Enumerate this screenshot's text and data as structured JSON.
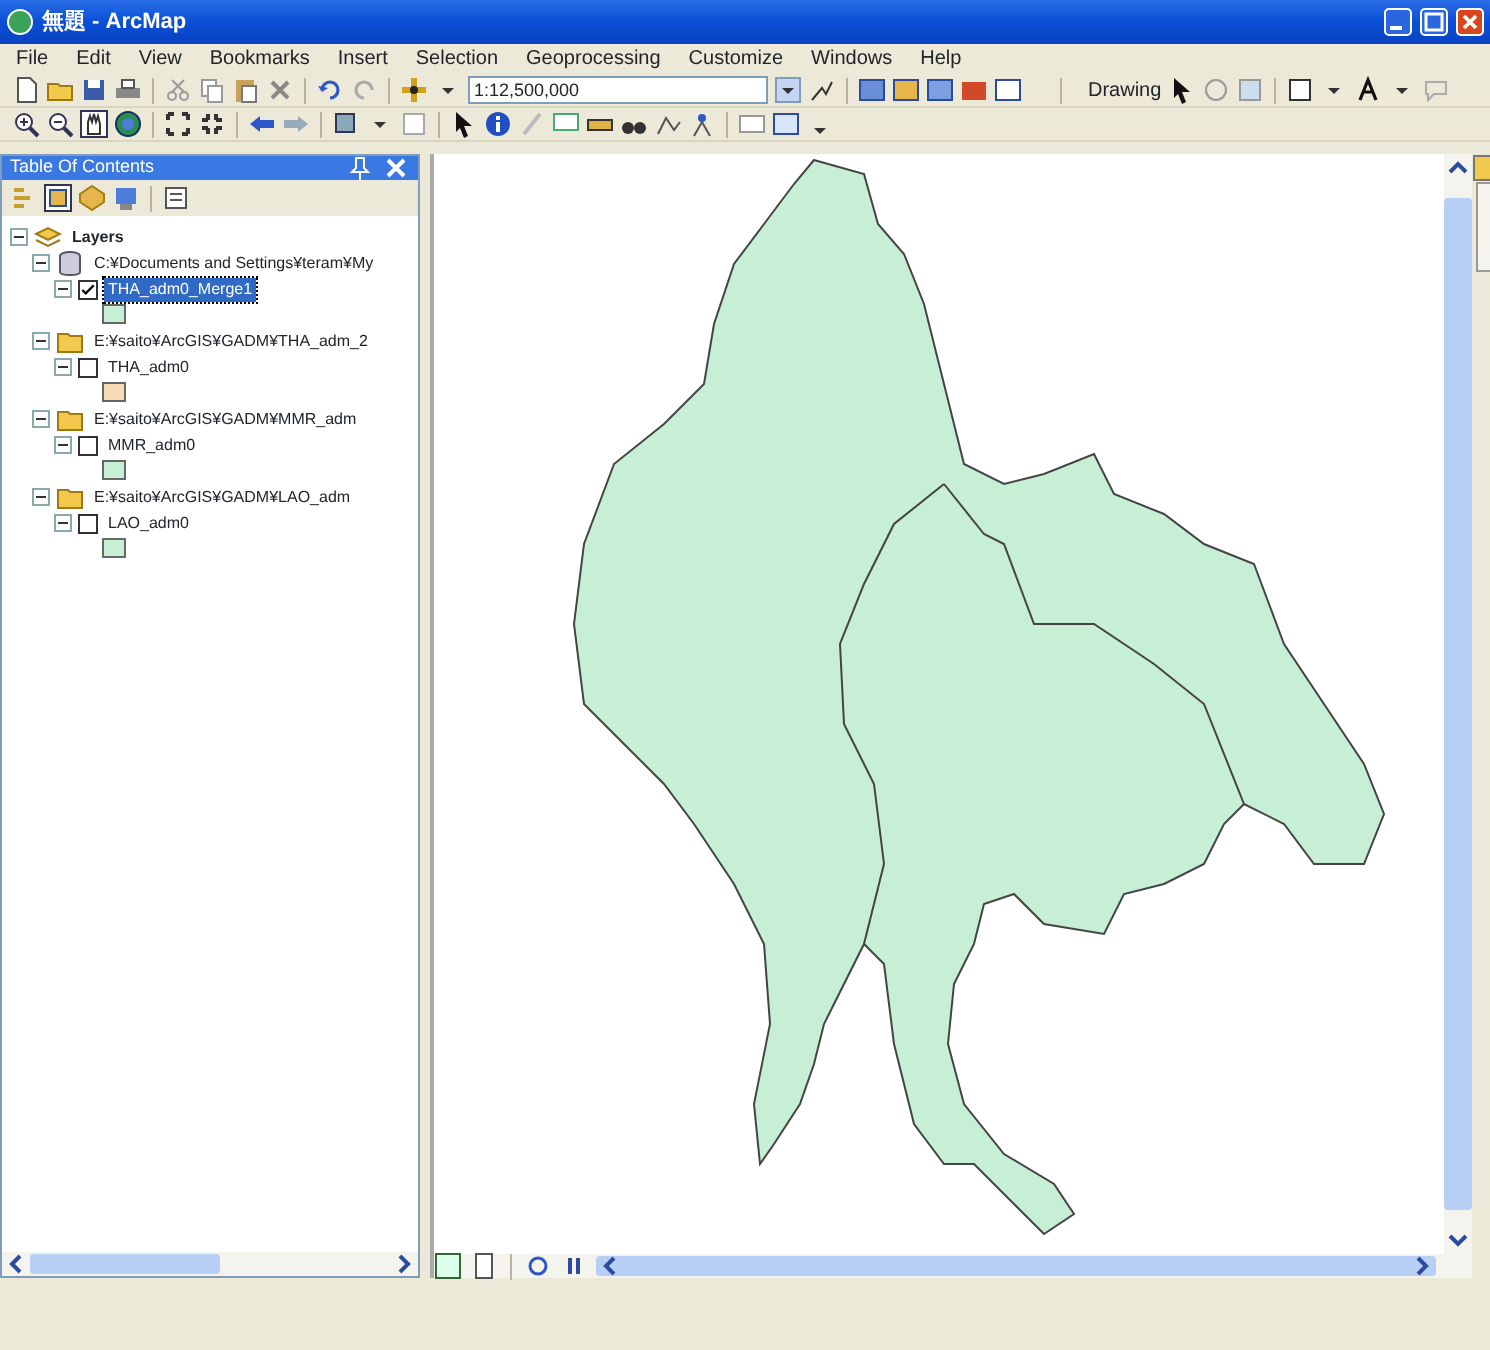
{
  "window": {
    "title": "無題 - ArcMap"
  },
  "menu": [
    "File",
    "Edit",
    "View",
    "Bookmarks",
    "Insert",
    "Selection",
    "Geoprocessing",
    "Customize",
    "Windows",
    "Help"
  ],
  "toolbar": {
    "scale": "1:12,500,000",
    "drawing_label": "Drawing"
  },
  "toc": {
    "title": "Table Of Contents",
    "root": {
      "label": "Layers",
      "expanded": true,
      "children": [
        {
          "label": "C:¥Documents and Settings¥teram¥My",
          "kind": "database",
          "expanded": true,
          "children": [
            {
              "label": "THA_adm0_Merge1",
              "checked": true,
              "selected": true,
              "color": "#c6efd6"
            }
          ]
        },
        {
          "label": "E:¥saito¥ArcGIS¥GADM¥THA_adm_2",
          "kind": "folder",
          "expanded": true,
          "children": [
            {
              "label": "THA_adm0",
              "checked": false,
              "selected": false,
              "color": "#f3dcb6"
            }
          ]
        },
        {
          "label": "E:¥saito¥ArcGIS¥GADM¥MMR_adm",
          "kind": "folder",
          "expanded": true,
          "children": [
            {
              "label": "MMR_adm0",
              "checked": false,
              "selected": false,
              "color": "#c6efd6"
            }
          ]
        },
        {
          "label": "E:¥saito¥ArcGIS¥GADM¥LAO_adm",
          "kind": "folder",
          "expanded": true,
          "children": [
            {
              "label": "LAO_adm0",
              "checked": false,
              "selected": false,
              "color": "#c6efd6"
            }
          ]
        }
      ]
    }
  }
}
